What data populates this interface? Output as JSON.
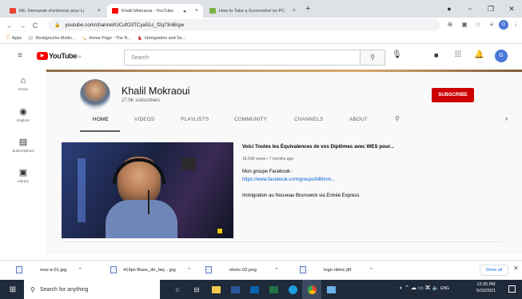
{
  "browser": {
    "tabs": [
      {
        "title": "RE: Demande d'entrevue pour Li",
        "active": false
      },
      {
        "title": "Khalil Mokraoui - YouTube",
        "active": true
      },
      {
        "title": "How to Take a Screenshot on PC",
        "active": false
      }
    ],
    "url": "youtube.com/channel/UCufO3TCya51c_f2q73nBrgw",
    "bookmarks": [
      "Apps",
      "Restigouche Multic...",
      "Home Page - The N...",
      "Immigration and Se..."
    ]
  },
  "youtube": {
    "logo_suffix": "CA",
    "search_placeholder": "Search",
    "avatar_initial": "G",
    "sidebar": [
      "Home",
      "Explore",
      "Subscriptions",
      "Library"
    ]
  },
  "channel": {
    "name": "Khalil Mokraoui",
    "subscribers": "27.5K subscribers",
    "subscribe_label": "SUBSCRIBE",
    "tabs": [
      "HOME",
      "VIDEOS",
      "PLAYLISTS",
      "COMMUNITY",
      "CHANNELS",
      "ABOUT"
    ]
  },
  "featured_video": {
    "title": "Voici Toutes les Équivalences de vos Diplômes avec WES pour...",
    "meta": "18,438 views • 7 months ago",
    "desc_line1": "Mon groupe Facebook :",
    "desc_link": "https://www.facebook.com/groups/NBImm...",
    "desc_line3": "Immigration au Nouveau Brunswick via Entrée Express"
  },
  "downloads": {
    "files": [
      "new a-01.jpg",
      "419px-Base_de_bej....jpg",
      "nbmc-02.png",
      "logo nbmc.jfif"
    ],
    "show_all": "Show all"
  },
  "taskbar": {
    "search_placeholder": "Search for anything",
    "lang": "ENG",
    "time": "12:20 PM",
    "date": "5/10/2021"
  },
  "colors": {
    "yt_red": "#ff0000",
    "subscribe_red": "#cc0000",
    "link_blue": "#065fd4",
    "taskbar": "#1f2a3a"
  }
}
